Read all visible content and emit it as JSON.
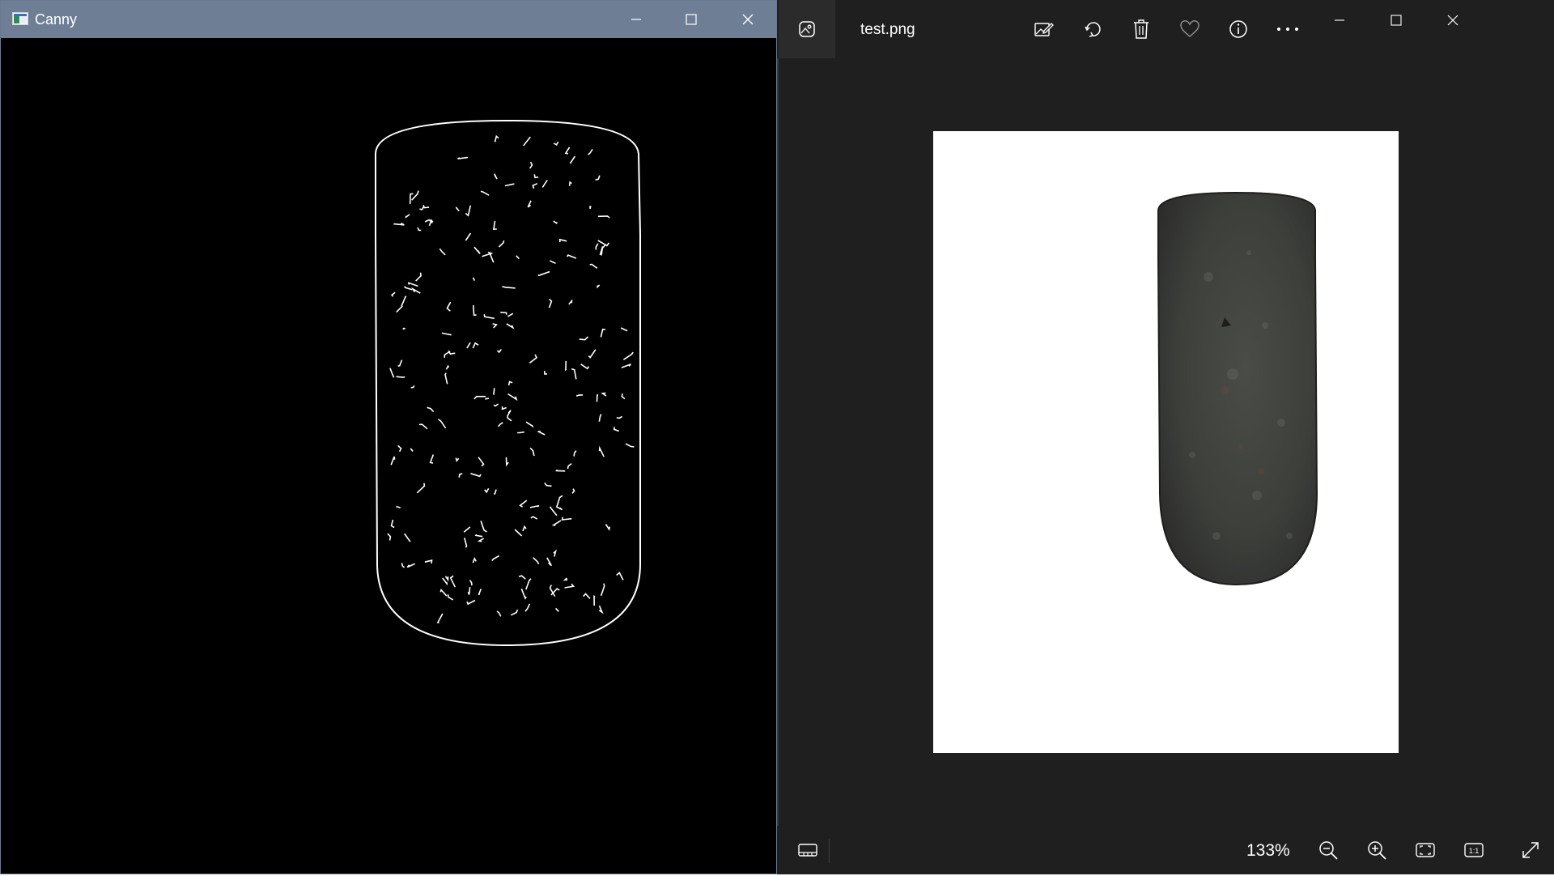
{
  "canny_window": {
    "title": "Canny",
    "icon": "app-image-icon",
    "controls": [
      "minimize-icon",
      "maximize-icon",
      "close-icon"
    ]
  },
  "photos_window": {
    "filename": "test.png",
    "toolbar_icons": [
      "edit-icon",
      "rotate-icon",
      "delete-icon",
      "heart-icon",
      "info-icon",
      "more-icon"
    ],
    "controls": [
      "minimize-icon",
      "maximize-icon",
      "close-icon"
    ],
    "zoom_level": "133%",
    "bottom_icons": [
      "filmstrip-icon",
      "zoom-out-icon",
      "zoom-in-icon",
      "fit-to-window-icon",
      "actual-size-icon",
      "fullscreen-icon"
    ],
    "actual_size_label": "1:1"
  },
  "colors": {
    "canny_titlebar": "#6e7f95",
    "viewer_background": "#1f1f1f",
    "edge_color": "#ffffff",
    "object_color": "#3d3f3d"
  }
}
